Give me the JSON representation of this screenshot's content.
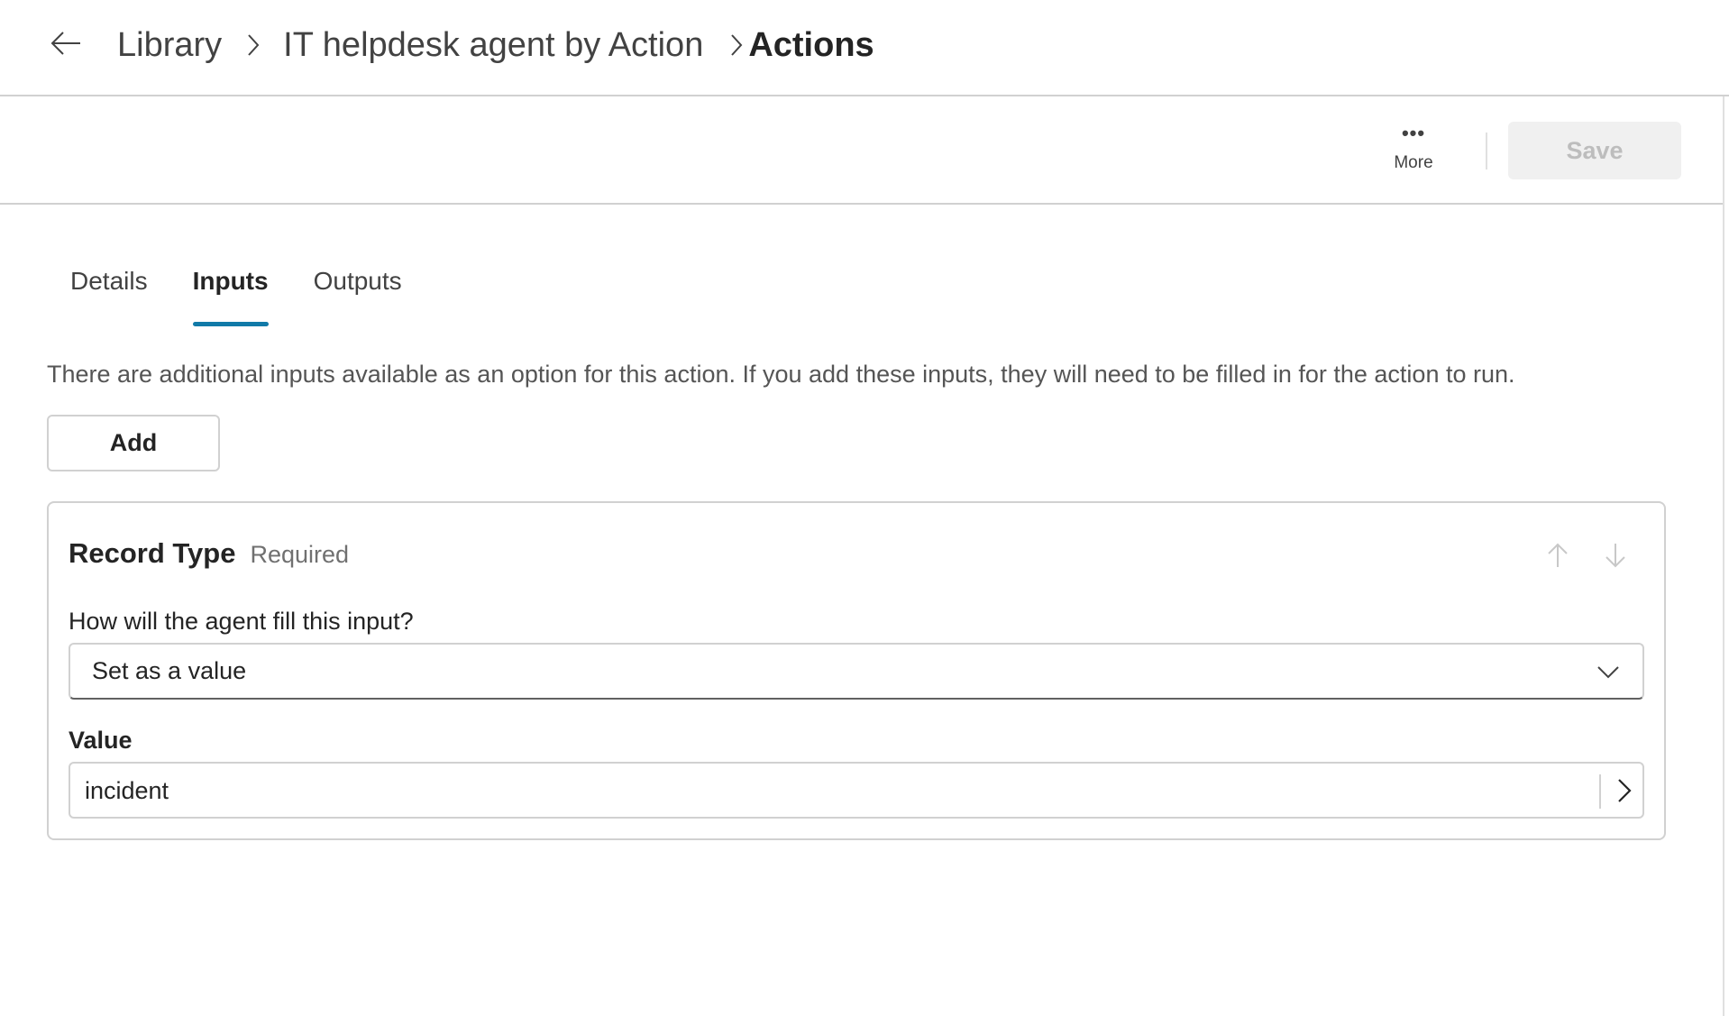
{
  "header": {
    "back_icon": "arrow-left-icon",
    "breadcrumb": [
      {
        "label": "Library"
      },
      {
        "label": "IT helpdesk agent by Action"
      },
      {
        "label": "Actions",
        "current": true
      }
    ],
    "separator_icon": "chevron-right-icon"
  },
  "toolbar": {
    "more_icon": "ellipsis-icon",
    "more_label": "More",
    "save_label": "Save",
    "save_disabled": true
  },
  "tabs": [
    {
      "label": "Details",
      "active": false
    },
    {
      "label": "Inputs",
      "active": true
    },
    {
      "label": "Outputs",
      "active": false
    }
  ],
  "accent_color": "#117aa8",
  "inputs_panel": {
    "description": "There are additional inputs available as an option for this action. If you add these inputs, they will need to be filled in for the action to run.",
    "add_label": "Add",
    "input_card": {
      "name": "Record Type",
      "required_label": "Required",
      "move_up_icon": "arrow-up-icon",
      "move_down_icon": "arrow-down-icon",
      "fill_question": "How will the agent fill this input?",
      "fill_method": "Set as a value",
      "value_label": "Value",
      "value": "incident"
    }
  }
}
